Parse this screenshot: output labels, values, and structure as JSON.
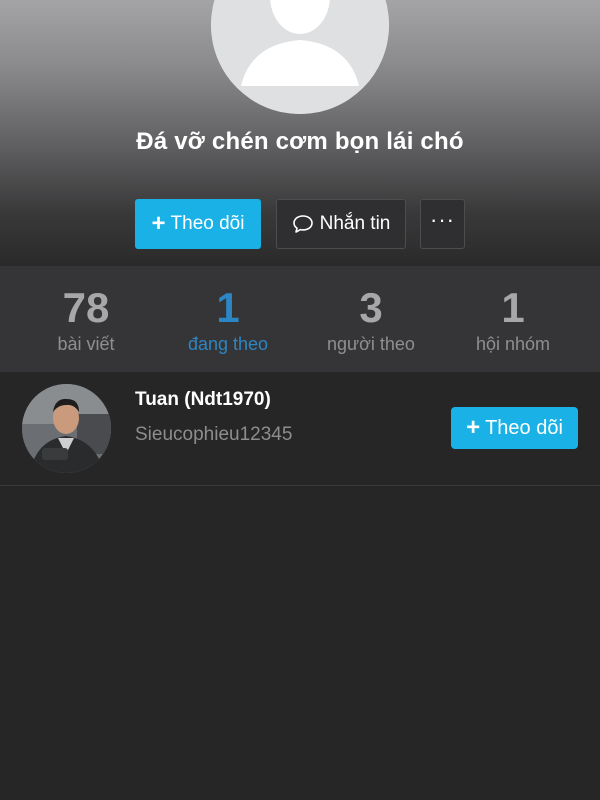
{
  "profile": {
    "name": "Đá vỡ chén cơm bọn lái chó"
  },
  "actions": {
    "follow_label": "Theo dõi",
    "message_label": "Nhắn tin",
    "more_label": "···"
  },
  "stats": [
    {
      "value": "78",
      "label": "bài viết",
      "active": false
    },
    {
      "value": "1",
      "label": "đang theo",
      "active": true
    },
    {
      "value": "3",
      "label": "người theo",
      "active": false
    },
    {
      "value": "1",
      "label": "hội nhóm",
      "active": false
    }
  ],
  "following": [
    {
      "name": "Tuan (Ndt1970)",
      "handle": "Sieucophieu12345",
      "follow_label": "Theo dõi"
    }
  ],
  "colors": {
    "accent": "#19b1e6",
    "active_tab": "#2c86c3",
    "background": "#262627"
  }
}
